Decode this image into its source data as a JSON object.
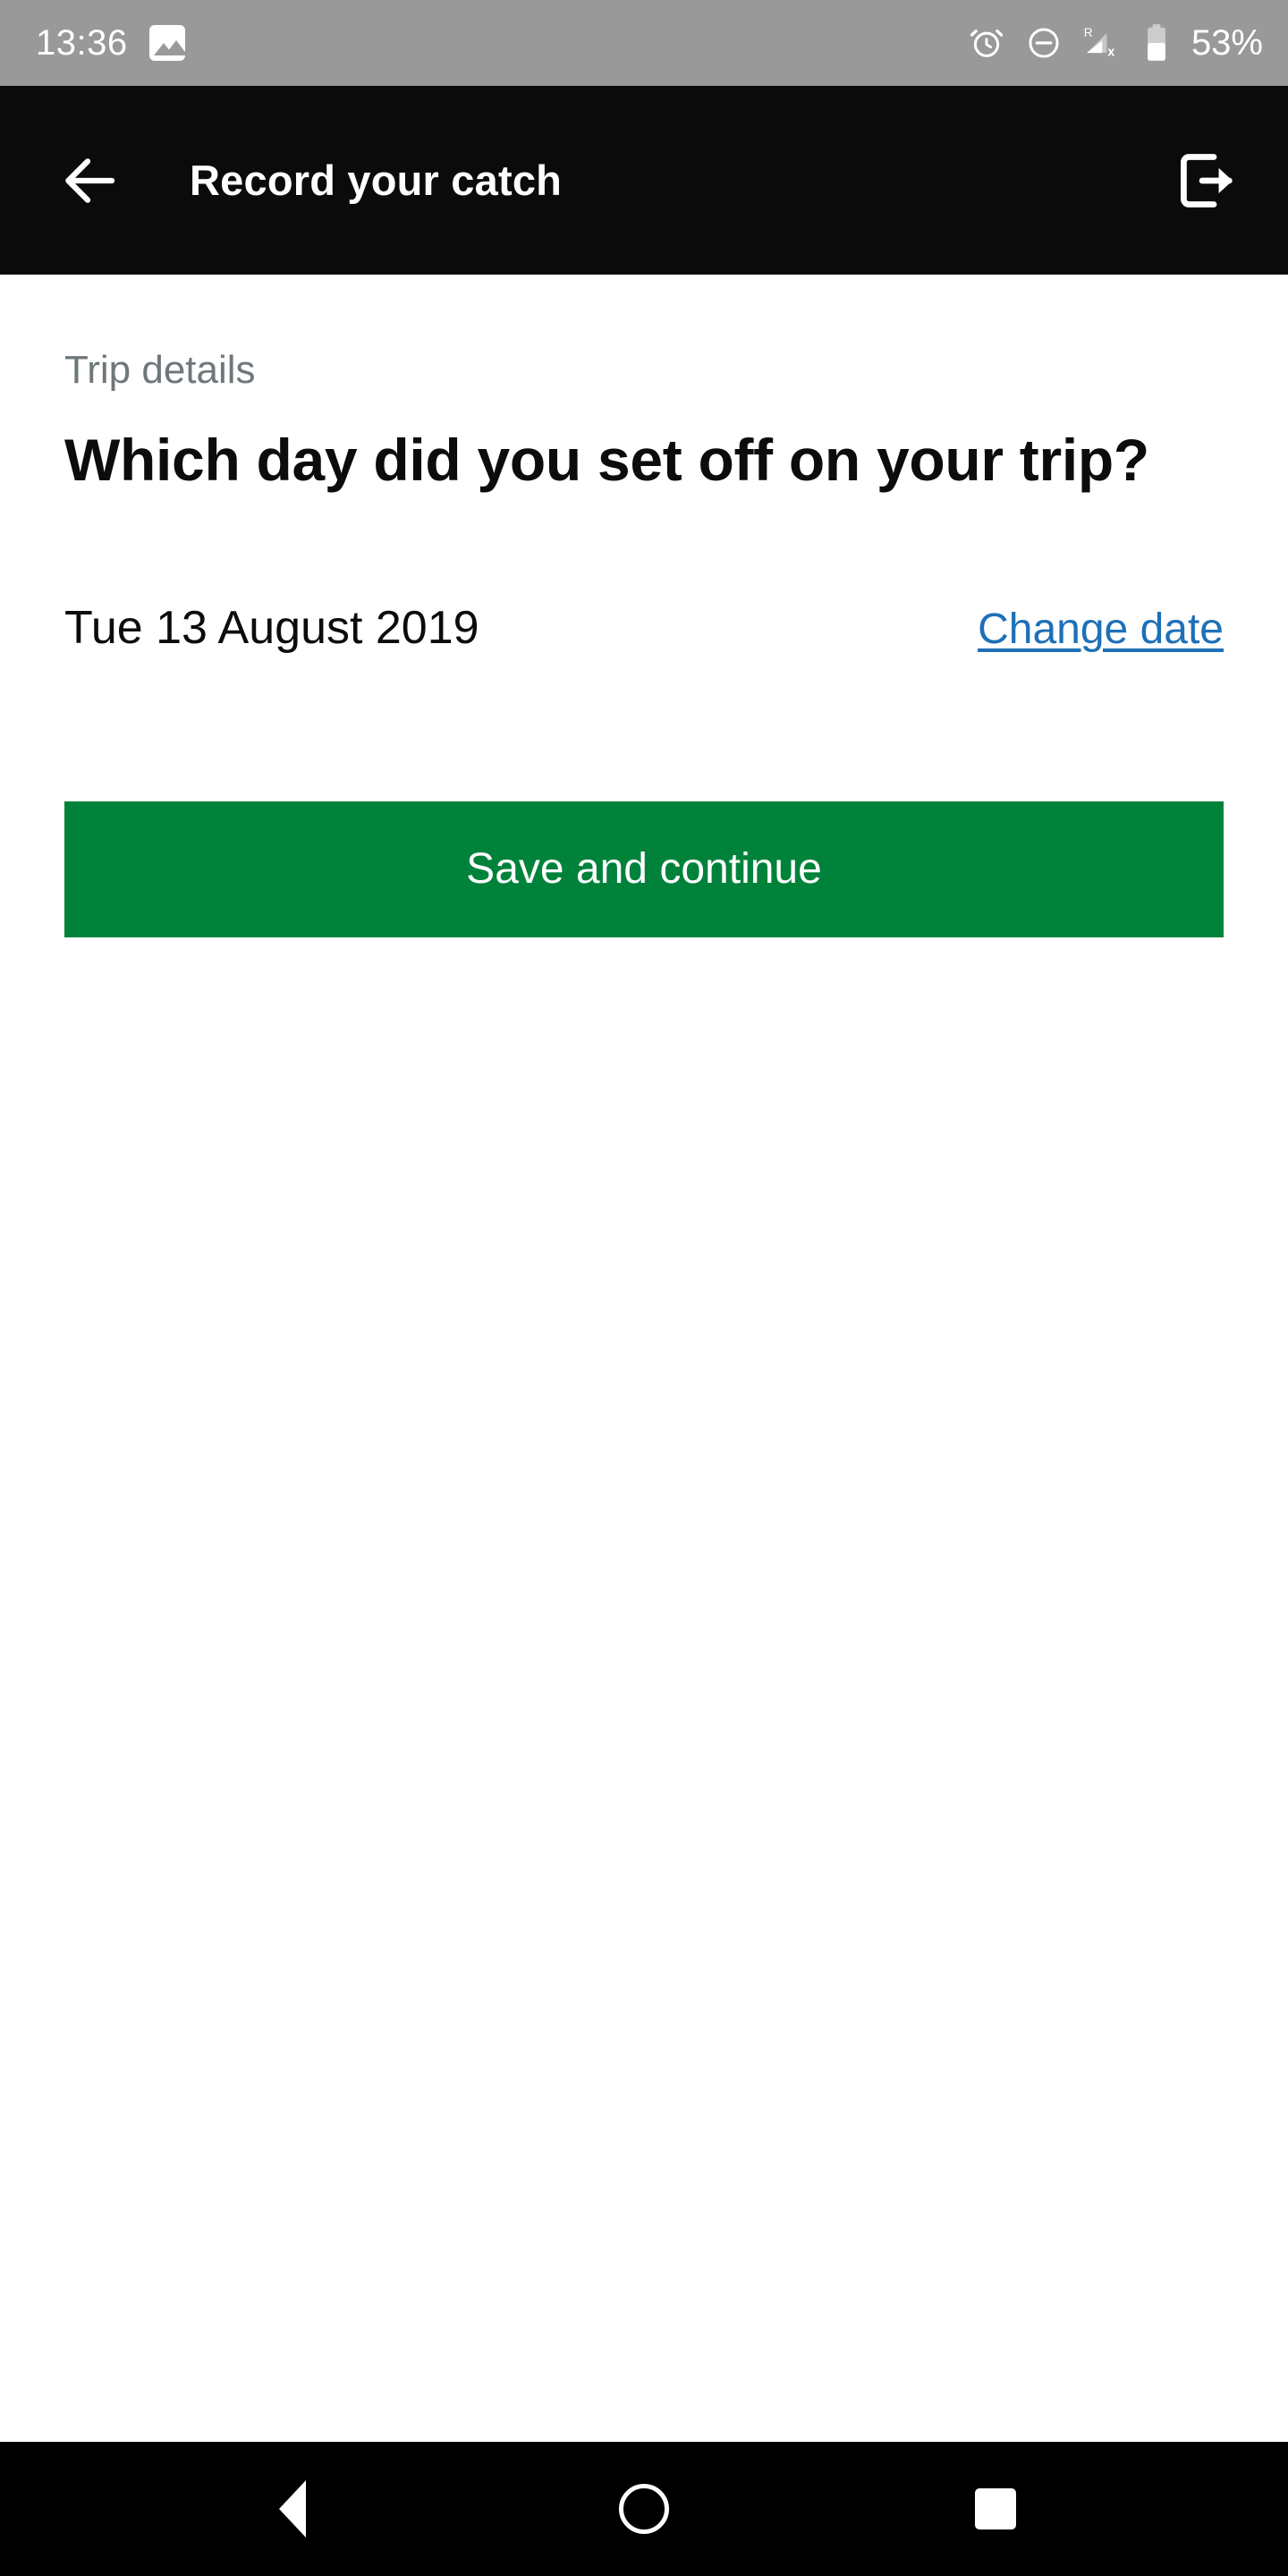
{
  "status_bar": {
    "time": "13:36",
    "battery_percent": "53%",
    "icons": [
      "photo-icon",
      "alarm-clock-icon",
      "do-not-disturb-icon",
      "roaming-no-signal-icon",
      "battery-icon"
    ],
    "background_color": "#999999",
    "foreground_color": "#ffffff"
  },
  "header": {
    "title": "Record your catch",
    "back_label": "Back",
    "exit_label": "Sign out",
    "background_color": "#0b0b0c",
    "text_color": "#ffffff"
  },
  "main": {
    "caption": "Trip details",
    "question": "Which day did you set off on your trip?",
    "date_value": "Tue 13 August 2019",
    "change_link": "Change date",
    "primary_button": "Save and continue",
    "caption_color": "#6f777b",
    "link_color": "#1d70b8",
    "button_color": "#00823b"
  },
  "nav_bar": {
    "back_label": "Back",
    "home_label": "Home",
    "recents_label": "Recent apps",
    "background_color": "#000000"
  }
}
